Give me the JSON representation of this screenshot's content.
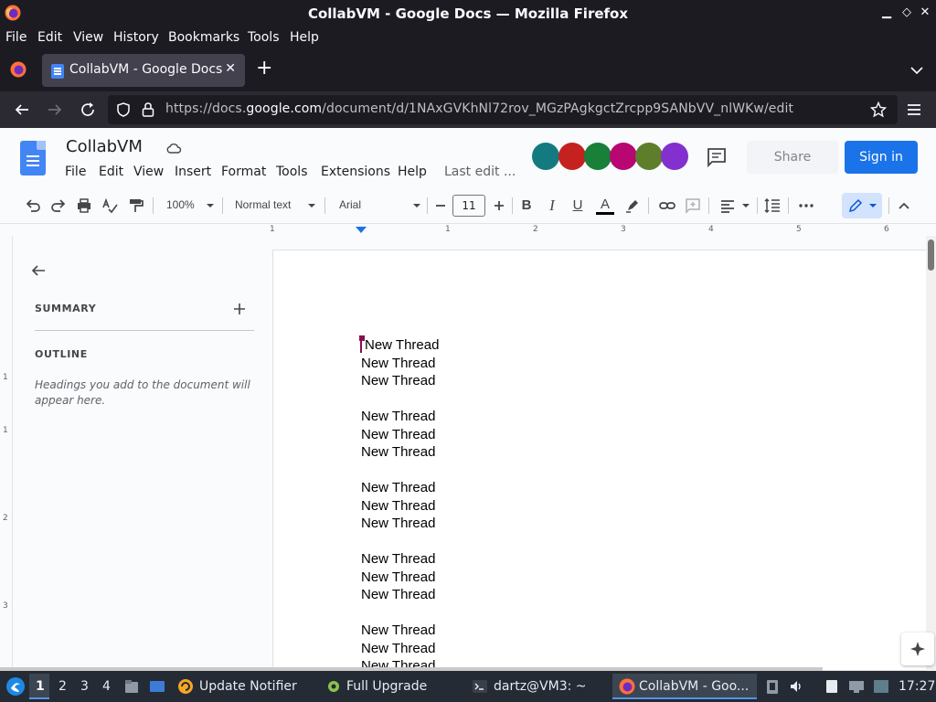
{
  "window": {
    "title": "CollabVM - Google Docs — Mozilla Firefox",
    "minimize": "▁",
    "maximize": "◇",
    "close": "✕"
  },
  "menubar": [
    "File",
    "Edit",
    "View",
    "History",
    "Bookmarks",
    "Tools",
    "Help"
  ],
  "tab": {
    "label": "CollabVM - Google Docs",
    "close": "✕",
    "new_tab": "+"
  },
  "urlbar": {
    "prefix": "https://docs.",
    "domain": "google.com",
    "path": "/document/d/1NAxGVKhNl72rov_MGzPAgkgctZrcpp9SANbVV_nlWKw/edit"
  },
  "docs": {
    "title": "CollabVM",
    "menus": [
      "File",
      "Edit",
      "View",
      "Insert",
      "Format",
      "Tools",
      "Extensions",
      "Help"
    ],
    "last_edit": "Last edit ...",
    "share": "Share",
    "sign_in": "Sign in",
    "avatar_colors": [
      "#137a7f",
      "#c5221f",
      "#188038",
      "#b80672",
      "#5e7e2c",
      "#8430ce"
    ]
  },
  "toolbar": {
    "zoom": "100%",
    "style": "Normal text",
    "font": "Arial",
    "font_size": "11",
    "bold": "B",
    "italic": "I",
    "underline": "U",
    "text_color": "A"
  },
  "ruler": [
    "1",
    "1",
    "2",
    "3",
    "4",
    "5",
    "6"
  ],
  "vruler": [
    "1",
    "1",
    "2",
    "3"
  ],
  "outline": {
    "summary": "SUMMARY",
    "outline": "OUTLINE",
    "hint": "Headings you add to the document will appear here."
  },
  "document": {
    "lines": [
      "New Thread",
      "New Thread",
      "New Thread",
      "",
      "New Thread",
      "New Thread",
      "New Thread",
      "",
      "New Thread",
      "New Thread",
      "New Thread",
      "",
      "New Thread",
      "New Thread",
      "New Thread",
      "",
      "New Thread",
      "New Thread",
      "New Thread"
    ]
  },
  "taskbar": {
    "workspaces": [
      "1",
      "2",
      "3",
      "4"
    ],
    "update_notifier": "Update Notifier",
    "full_upgrade": "Full Upgrade",
    "terminal": "dartz@VM3: ~",
    "firefox": "CollabVM - Goo...",
    "clock": "17:27"
  }
}
